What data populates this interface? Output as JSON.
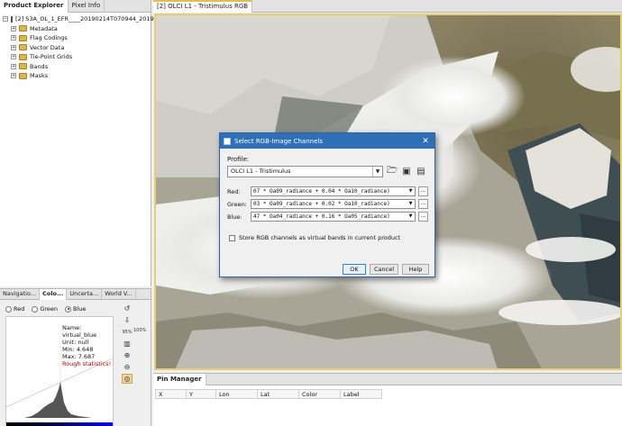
{
  "explorer": {
    "tabs": [
      "Product Explorer",
      "Pixel Info"
    ],
    "product": "[2] S3A_OL_1_EFR____20190214T070944_20190214T07",
    "nodes": [
      "Metadata",
      "Flag Codings",
      "Vector Data",
      "Tie-Point Grids",
      "Bands",
      "Masks"
    ]
  },
  "color_panel": {
    "tabs": [
      "Navigatio...",
      "Colo...",
      "Uncerta...",
      "World V..."
    ],
    "radios": [
      "Red",
      "Green",
      "Blue"
    ],
    "selected_radio": "Blue",
    "stats": {
      "name": "Name: virtual_blue",
      "unit": "Unit: null",
      "min": "Min: 4.648",
      "max": "Max: 7.687",
      "note": "Rough statistics!"
    },
    "zoom_labels": [
      "95%",
      "100%"
    ]
  },
  "view": {
    "tab": "[2] OLCI L1 - Tristimulus RGB"
  },
  "pin_manager": {
    "tab": "Pin Manager",
    "columns": [
      "X",
      "Y",
      "Lon",
      "Lat",
      "Color",
      "Label"
    ]
  },
  "dialog": {
    "title": "Select RGB-Image Channels",
    "close_glyph": "✕",
    "profile_label": "Profile:",
    "profile_value": "OLCI L1 - Tristimulus",
    "channels": [
      {
        "label": "Red:",
        "expr": "07 * Oa09_radiance + 0.04 * Oa10_radiance)"
      },
      {
        "label": "Green:",
        "expr": "03 * Oa09_radiance + 0.02 * Oa10_radiance)"
      },
      {
        "label": "Blue:",
        "expr": "47 * Oa04_radiance + 0.16 * Oa05_radiance)"
      }
    ],
    "dots_label": "...",
    "checkbox_label": "Store RGB channels as virtual bands in current product",
    "buttons": {
      "ok": "OK",
      "cancel": "Cancel",
      "help": "Help"
    }
  },
  "colors": {
    "title_bar": "#2f6fb7",
    "view_border": "#e6cf73",
    "stats_warning": "#b30000"
  }
}
